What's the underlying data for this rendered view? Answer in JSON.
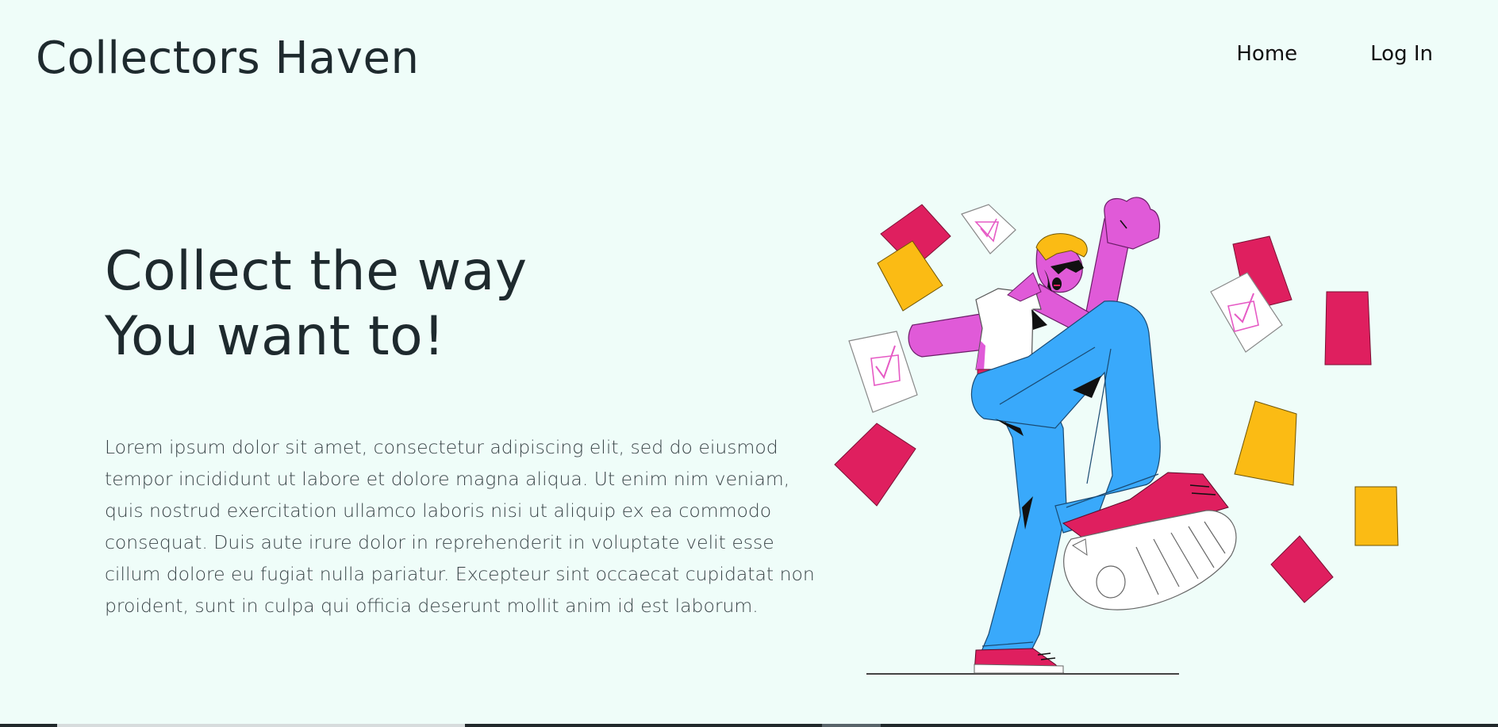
{
  "header": {
    "brand": "Collectors Haven",
    "nav": [
      {
        "label": "Home"
      },
      {
        "label": "Log In"
      }
    ]
  },
  "hero": {
    "title_line1": "Collect the way",
    "title_line2": "You want to!",
    "body": "Lorem ipsum dolor sit amet, consectetur adipiscing elit, sed do eiusmod tempor incididunt ut labore et dolore magna aliqua. Ut enim nim veniam, quis nostrud exercitation ullamco laboris nisi ut aliquip ex ea commodo consequat. Duis aute irure dolor in reprehenderit in voluptate velit esse cillum dolore eu fugiat nulla pariatur. Excepteur sint occaecat cupidatat non proident, sunt in culpa qui officia deserunt mollit anim id est laborum."
  },
  "colors": {
    "background": "#effdf9",
    "text": "#1e2a2e",
    "magenta": "#df1f5f",
    "yellow": "#fbbb14",
    "skin": "#e05ad8",
    "jeans": "#39a9fb"
  },
  "illustration": {
    "icon": "celebrating-person-with-flying-cards-illustration"
  }
}
